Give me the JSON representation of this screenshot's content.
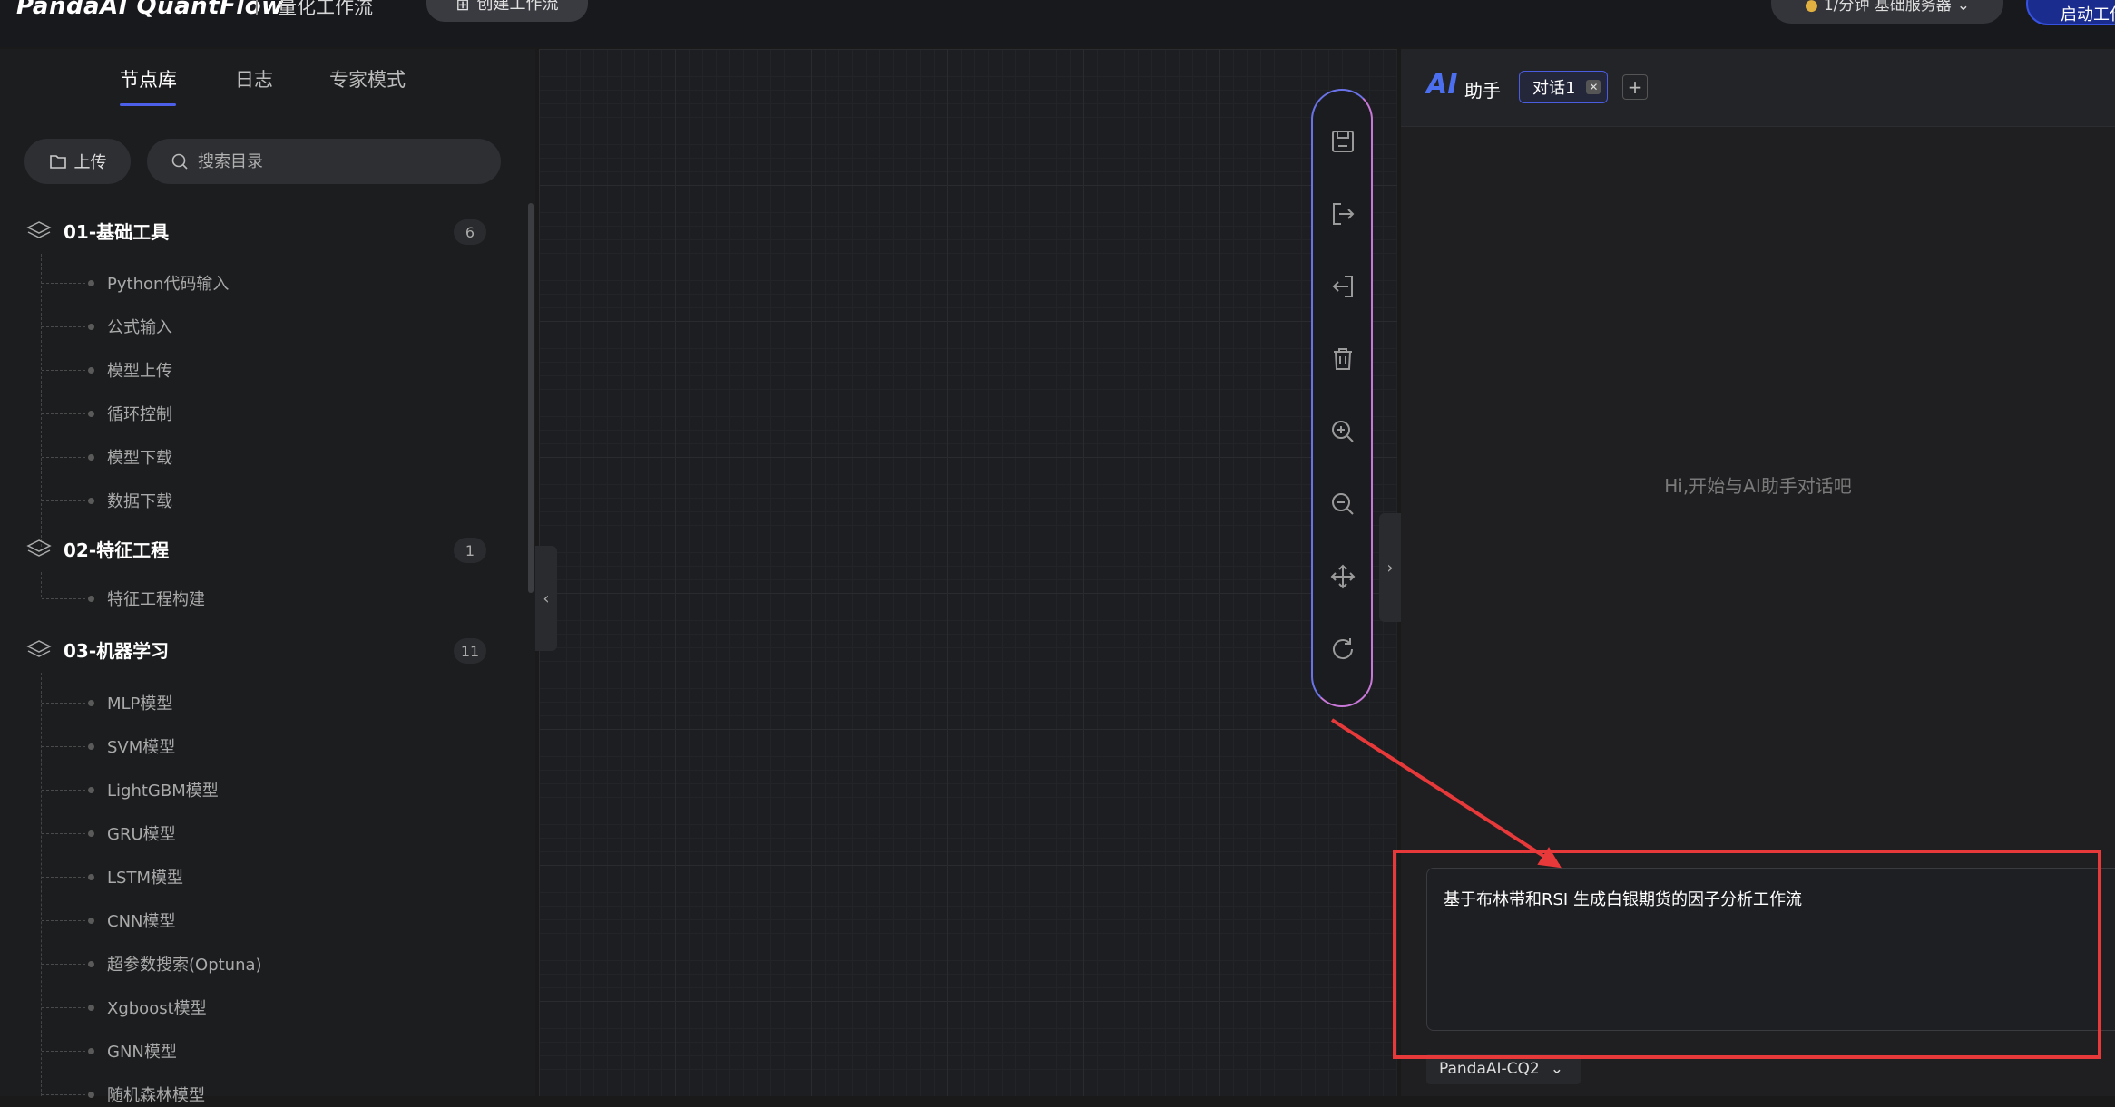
{
  "header": {
    "logo": "PandaAI QuantFlow",
    "subtitle": "量化工作流",
    "create_label": "创建工作流",
    "server_label": "1/分钟 基础服务器",
    "start_label": "启动工作流"
  },
  "sidebar": {
    "tabs": [
      "节点库",
      "日志",
      "专家模式"
    ],
    "active_tab": "节点库",
    "upload_label": "上传",
    "search_placeholder": "搜索目录",
    "groups": [
      {
        "title": "01-基础工具",
        "count": "6",
        "items": [
          "Python代码输入",
          "公式输入",
          "模型上传",
          "循环控制",
          "模型下载",
          "数据下载"
        ]
      },
      {
        "title": "02-特征工程",
        "count": "1",
        "items": [
          "特征工程构建"
        ]
      },
      {
        "title": "03-机器学习",
        "count": "11",
        "items": [
          "MLP模型",
          "SVM模型",
          "LightGBM模型",
          "GRU模型",
          "LSTM模型",
          "CNN模型",
          "超参数搜索(Optuna)",
          "Xgboost模型",
          "GNN模型",
          "随机森林模型"
        ]
      }
    ]
  },
  "canvas": {
    "tools": [
      "save-icon",
      "export-icon",
      "import-icon",
      "delete-icon",
      "zoom-in-icon",
      "zoom-out-icon",
      "move-icon",
      "refresh-icon"
    ]
  },
  "ai_panel": {
    "logo": "AI",
    "title": "助手",
    "chat_tab": "对话1",
    "empty_hint": "Hi,开始与AI助手对话吧",
    "prompt_value": "基于布林带和RSI 生成白银期货的因子分析工作流",
    "model": "PandaAI-CQ2"
  },
  "colors": {
    "accent": "#4c5fe8",
    "annotation": "#e8393a"
  }
}
